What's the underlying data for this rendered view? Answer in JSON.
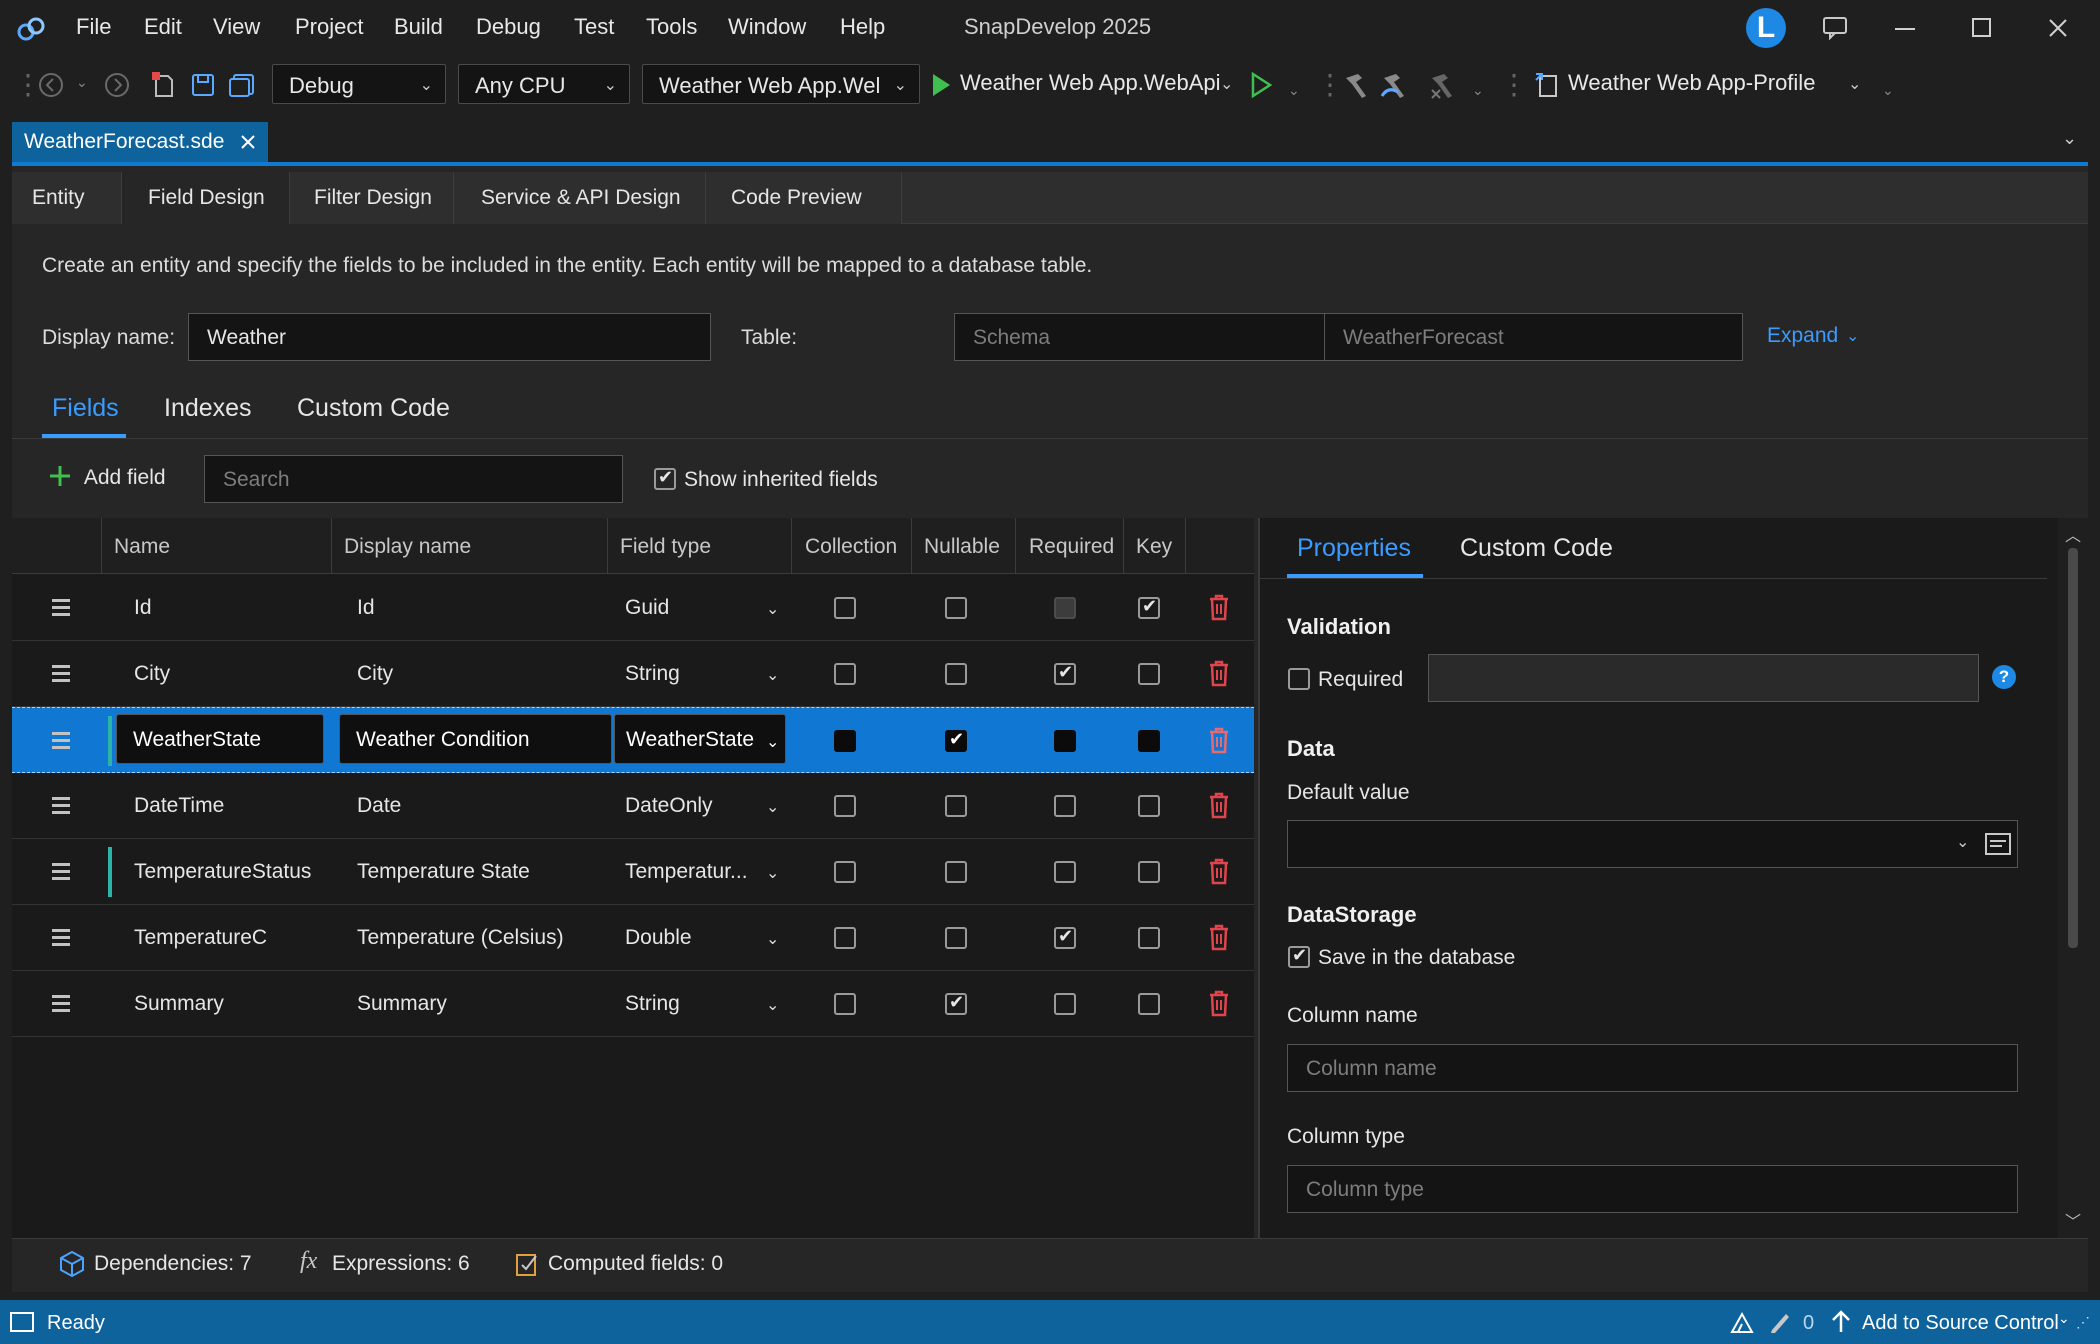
{
  "app": {
    "title": "SnapDevelop 2025",
    "user_initial": "L"
  },
  "menu": [
    "File",
    "Edit",
    "View",
    "Project",
    "Build",
    "Debug",
    "Test",
    "Tools",
    "Window",
    "Help"
  ],
  "toolbar": {
    "config": "Debug",
    "platform": "Any CPU",
    "startup": "Weather Web App.Wel",
    "run_target": "Weather Web App.WebApi",
    "profile": "Weather Web App-Profile"
  },
  "doc_tab": "WeatherForecast.sde",
  "designer_tabs": [
    "Entity",
    "Field Design",
    "Filter Design",
    "Service & API Design",
    "Code Preview"
  ],
  "description": "Create an entity and specify the fields to be included in the entity.  Each entity will be mapped to a database table.",
  "form": {
    "display_name_label": "Display name:",
    "display_name_value": "Weather",
    "table_label": "Table:",
    "schema_placeholder": "Schema",
    "table_placeholder": "WeatherForecast",
    "expand_label": "Expand"
  },
  "sub_tabs": [
    "Fields",
    "Indexes",
    "Custom Code"
  ],
  "field_bar": {
    "add_label": "Add field",
    "search_placeholder": "Search",
    "show_inherited_label": "Show inherited fields"
  },
  "grid": {
    "headers": [
      "Name",
      "Display name",
      "Field type",
      "Collection",
      "Nullable",
      "Required",
      "Key"
    ],
    "rows": [
      {
        "name": "Id",
        "display": "Id",
        "type": "Guid",
        "collection": false,
        "nullable": false,
        "required": false,
        "key": true
      },
      {
        "name": "City",
        "display": "City",
        "type": "String",
        "collection": false,
        "nullable": false,
        "required": true,
        "key": false
      },
      {
        "name": "WeatherState",
        "display": "Weather Condition",
        "type": "WeatherState",
        "collection": false,
        "nullable": true,
        "required": false,
        "key": false
      },
      {
        "name": "DateTime",
        "display": "Date",
        "type": "DateOnly",
        "collection": false,
        "nullable": false,
        "required": false,
        "key": false
      },
      {
        "name": "TemperatureStatus",
        "display": "Temperature State",
        "type": "Temperatur...",
        "collection": false,
        "nullable": false,
        "required": false,
        "key": false
      },
      {
        "name": "TemperatureC",
        "display": "Temperature (Celsius)",
        "type": "Double",
        "collection": false,
        "nullable": false,
        "required": true,
        "key": false
      },
      {
        "name": "Summary",
        "display": "Summary",
        "type": "String",
        "collection": false,
        "nullable": true,
        "required": false,
        "key": false
      }
    ]
  },
  "props": {
    "tabs": [
      "Properties",
      "Custom Code"
    ],
    "validation_title": "Validation",
    "required_label": "Required",
    "data_title": "Data",
    "default_value_label": "Default value",
    "storage_title": "DataStorage",
    "save_db_label": "Save in the database",
    "column_name_label": "Column name",
    "column_name_placeholder": "Column name",
    "column_type_label": "Column type",
    "column_type_placeholder": "Column type"
  },
  "footer": {
    "dependencies": "Dependencies: 7",
    "expressions": "Expressions: 6",
    "computed": "Computed fields: 0"
  },
  "status": {
    "ready": "Ready",
    "count": "0",
    "source_control": "Add to Source Control"
  },
  "colors": {
    "accent": "#1077d3",
    "link": "#3b9cff",
    "danger": "#e0454d",
    "status_bar": "#0e639c"
  }
}
